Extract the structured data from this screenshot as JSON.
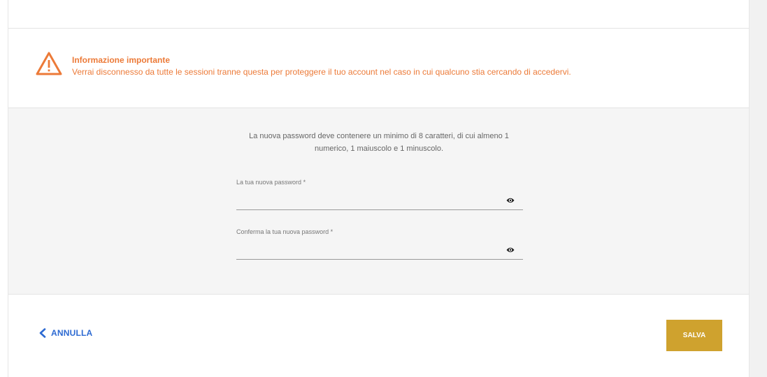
{
  "warning": {
    "title": "Informazione importante",
    "message": "Verrai disconnesso da tutte le sessioni tranne questa per proteggere il tuo account nel caso in cui qualcuno stia cercando di accedervi.",
    "icon": "warning-triangle-icon",
    "color": "#ec7a38"
  },
  "form": {
    "hint": "La nuova password deve contenere un minimo di 8 caratteri, di cui almeno 1 numerico, 1 maiuscolo e 1 minuscolo.",
    "new_password": {
      "label": "La tua nuova password  *",
      "value": "",
      "icon": "eye-icon"
    },
    "confirm_password": {
      "label": "Conferma la tua nuova password  *",
      "value": "",
      "icon": "eye-icon"
    }
  },
  "footer": {
    "cancel_label": "ANNULLA",
    "cancel_icon": "chevron-left-icon",
    "save_label": "SALVA",
    "accent_color": "#cfa22e",
    "link_color": "#2d6ad2"
  }
}
